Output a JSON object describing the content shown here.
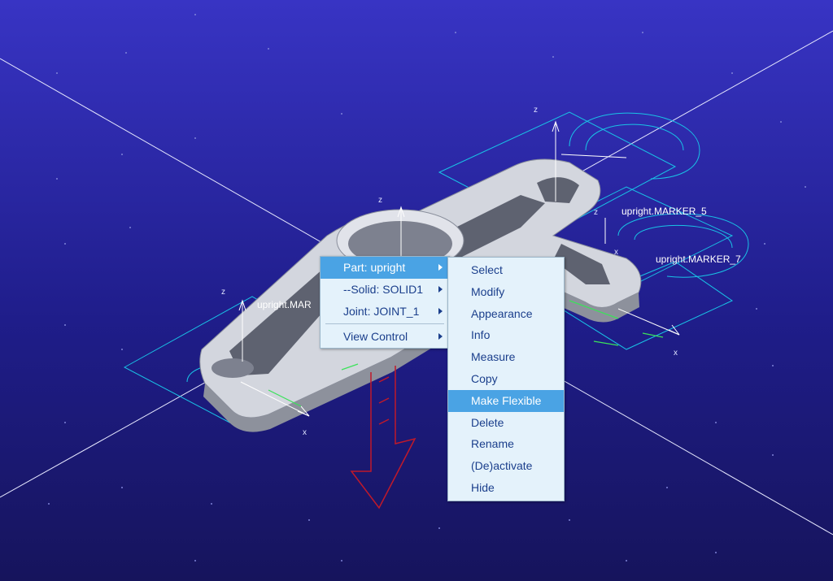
{
  "labels": {
    "marker_5": "upright.MARKER_5",
    "marker_7": "upright.MARKER_7",
    "marker_left": "upright.MAR"
  },
  "axis_letters": {
    "z": "z",
    "x": "x"
  },
  "context_menu": {
    "items": [
      {
        "label": "Part: upright",
        "submenu": true,
        "highlighted": true
      },
      {
        "label": "--Solid: SOLID1",
        "submenu": true
      },
      {
        "label": "Joint: JOINT_1",
        "submenu": true
      },
      {
        "label": "View Control",
        "submenu": true,
        "separator_before": true
      }
    ]
  },
  "submenu": {
    "items": [
      {
        "label": "Select"
      },
      {
        "label": "Modify"
      },
      {
        "label": "Appearance"
      },
      {
        "label": "Info"
      },
      {
        "label": "Measure"
      },
      {
        "label": "Copy"
      },
      {
        "label": "Make Flexible",
        "highlighted": true
      },
      {
        "label": "Delete"
      },
      {
        "label": "Rename"
      },
      {
        "label": "(De)activate"
      },
      {
        "label": "Hide"
      }
    ]
  },
  "colors": {
    "background_top": "#3834c4",
    "background_bottom": "#16145c",
    "marker_lines": "#19c3e6",
    "highlight": "#4aa3e4",
    "menu_text": "#1b3f8c",
    "force_arrow": "#c0192a"
  }
}
